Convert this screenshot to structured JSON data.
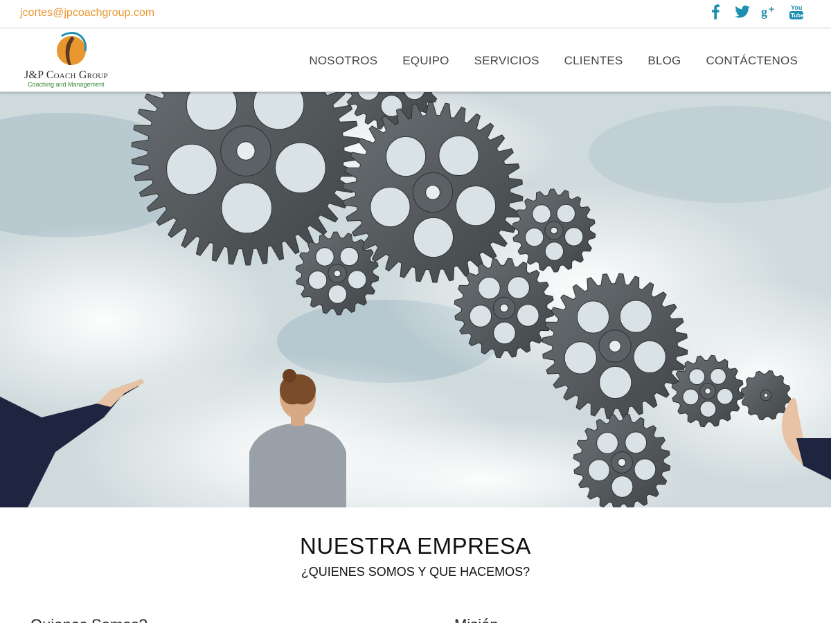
{
  "topbar": {
    "email": "jcortes@jpcoachgroup.com",
    "social": [
      {
        "icon": "facebook-icon"
      },
      {
        "icon": "twitter-icon"
      },
      {
        "icon": "google-plus-icon"
      },
      {
        "icon": "youtube-icon",
        "label_top": "You",
        "label_bottom": "Tube"
      }
    ],
    "accent_color": "#e8962e",
    "icon_color": "#1e8fb0"
  },
  "logo": {
    "brand_prefix": "J&P",
    "brand_name": "Coach Group",
    "tagline": "Coaching and Management"
  },
  "nav": {
    "items": [
      "NOSOTROS",
      "EQUIPO",
      "SERVICIOS",
      "CLIENTES",
      "BLOG",
      "CONTÁCTENOS"
    ]
  },
  "section": {
    "title": "NUESTRA EMPRESA",
    "subtitle": "¿QUIENES SOMOS Y QUE HACEMOS?",
    "left_heading": "Quienes Somos?",
    "right_heading": "Misión"
  }
}
